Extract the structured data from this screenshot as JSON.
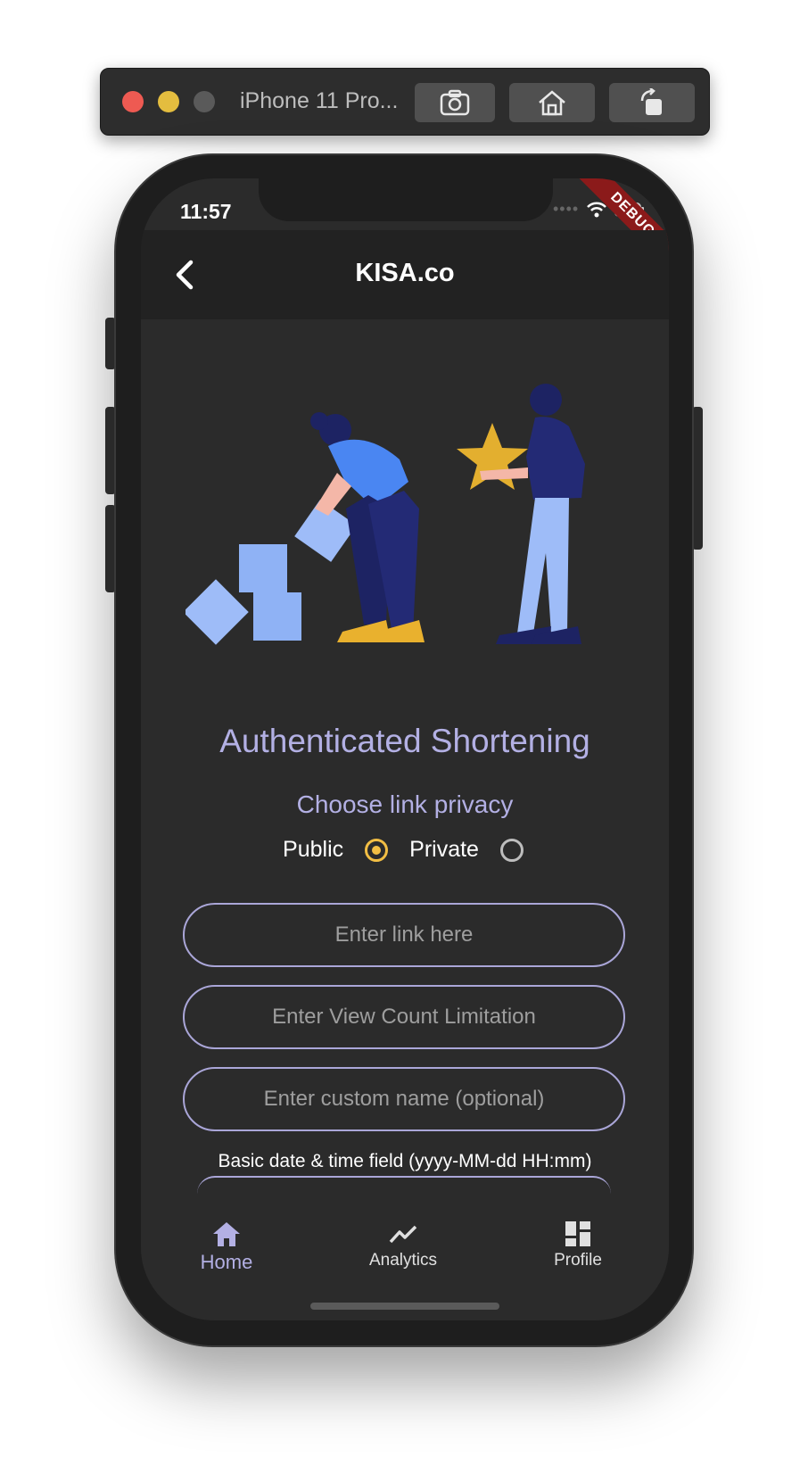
{
  "simulator": {
    "title": "iPhone 11 Pro...",
    "buttons": [
      "screenshot",
      "home",
      "rotate"
    ]
  },
  "status_bar": {
    "time": "11:57",
    "debug_label": "DEBUG"
  },
  "app_bar": {
    "title": "KISA.co",
    "back_icon": "chevron-left-icon"
  },
  "main": {
    "heading": "Authenticated Shortening",
    "privacy_prompt": "Choose link privacy",
    "privacy_options": [
      {
        "label": "Public",
        "selected": true
      },
      {
        "label": "Private",
        "selected": false
      }
    ],
    "fields": [
      {
        "placeholder": "Enter link here"
      },
      {
        "placeholder": "Enter View Count Limitation"
      },
      {
        "placeholder": "Enter custom name (optional)"
      }
    ],
    "date_field_label": "Basic date & time field (yyyy-MM-dd HH:mm)"
  },
  "bottom_nav": {
    "items": [
      {
        "label": "Home",
        "icon": "home-icon",
        "active": true
      },
      {
        "label": "Analytics",
        "icon": "trending-icon",
        "active": false
      },
      {
        "label": "Profile",
        "icon": "dashboard-icon",
        "active": false
      }
    ]
  },
  "colors": {
    "accent": "#b3b0e4",
    "radio_selected": "#f2be44",
    "background": "#2b2b2b",
    "appbar": "#222222"
  }
}
